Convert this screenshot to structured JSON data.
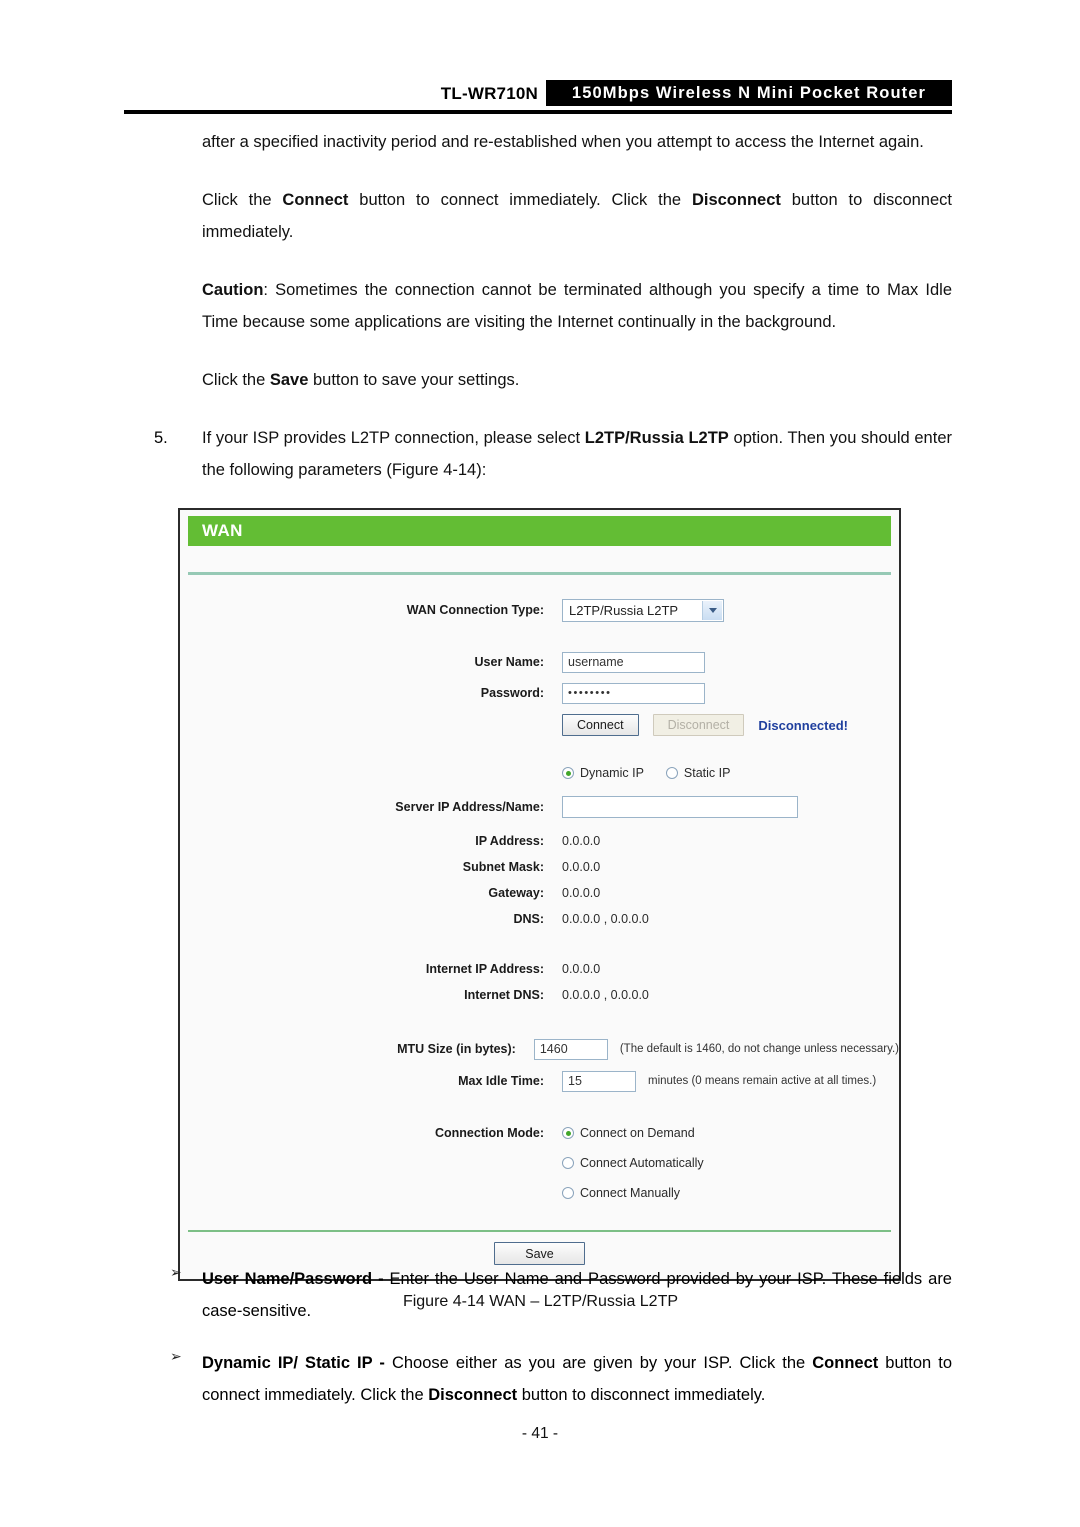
{
  "header": {
    "model": "TL-WR710N",
    "tagline": "150Mbps Wireless N Mini Pocket Router"
  },
  "body": {
    "para_continued": "after a specified inactivity period and re-established when you attempt to access the Internet again.",
    "para_connect_pre": "Click the ",
    "para_connect_b1": "Connect",
    "para_connect_mid": " button to connect immediately. Click the ",
    "para_connect_b2": "Disconnect",
    "para_connect_post": " button to disconnect immediately.",
    "caution_label": "Caution",
    "caution_text": ": Sometimes the connection cannot be terminated although you specify a time to Max Idle Time because some applications are visiting the Internet continually in the background.",
    "para_save_pre": "Click the ",
    "para_save_b": "Save",
    "para_save_post": " button to save your settings.",
    "item5_number": "5.",
    "item5_pre": "If your ISP provides L2TP connection, please select ",
    "item5_bold": "L2TP/Russia L2TP",
    "item5_post": " option. Then you should enter the following parameters (Figure 4-14):"
  },
  "wan": {
    "panel_title": "WAN",
    "connection_type_label": "WAN Connection Type:",
    "connection_type_value": "L2TP/Russia L2TP",
    "user_name_label": "User Name:",
    "user_name_value": "username",
    "password_label": "Password:",
    "password_value": "••••••••",
    "connect_button": "Connect",
    "disconnect_button": "Disconnect",
    "status": "Disconnected!",
    "ip_mode": {
      "dynamic_label": "Dynamic IP",
      "static_label": "Static IP",
      "selected": "Dynamic IP"
    },
    "server_ip_label": "Server IP Address/Name:",
    "server_ip_value": "",
    "readonly_fields": [
      {
        "label": "IP Address:",
        "value": "0.0.0.0"
      },
      {
        "label": "Subnet Mask:",
        "value": "0.0.0.0"
      },
      {
        "label": "Gateway:",
        "value": "0.0.0.0"
      },
      {
        "label": "DNS:",
        "value": "0.0.0.0 , 0.0.0.0"
      }
    ],
    "internet_fields": [
      {
        "label": "Internet IP Address:",
        "value": "0.0.0.0"
      },
      {
        "label": "Internet DNS:",
        "value": "0.0.0.0 , 0.0.0.0"
      }
    ],
    "mtu_label": "MTU Size (in bytes):",
    "mtu_value": "1460",
    "mtu_hint": "(The default is 1460, do not change unless necessary.)",
    "max_idle_label": "Max Idle Time:",
    "max_idle_value": "15",
    "max_idle_hint": "minutes (0 means remain active at all times.)",
    "connection_mode_label": "Connection Mode:",
    "connection_modes": [
      {
        "label": "Connect on Demand",
        "selected": true
      },
      {
        "label": "Connect Automatically",
        "selected": false
      },
      {
        "label": "Connect Manually",
        "selected": false
      }
    ],
    "save_button": "Save",
    "accent_green": "#63bd34",
    "status_blue": "#1f3f9e"
  },
  "figure_caption": "Figure 4-14 WAN – L2TP/Russia L2TP",
  "bullets": [
    {
      "marker": "➢",
      "bold": "User Name/Password - ",
      "text": "Enter the User Name and Password provided by your ISP. These fields are case-sensitive."
    },
    {
      "marker": "➢",
      "bold2_a": "Dynamic IP/ Static IP - ",
      "text_a": "Choose either as you are given by your ISP. Click the ",
      "bold2_b": "Connect",
      "text_b": " button to connect immediately. Click the ",
      "bold2_c": "Disconnect",
      "text_c": " button to disconnect immediately."
    }
  ],
  "page_number": "- 41 -"
}
